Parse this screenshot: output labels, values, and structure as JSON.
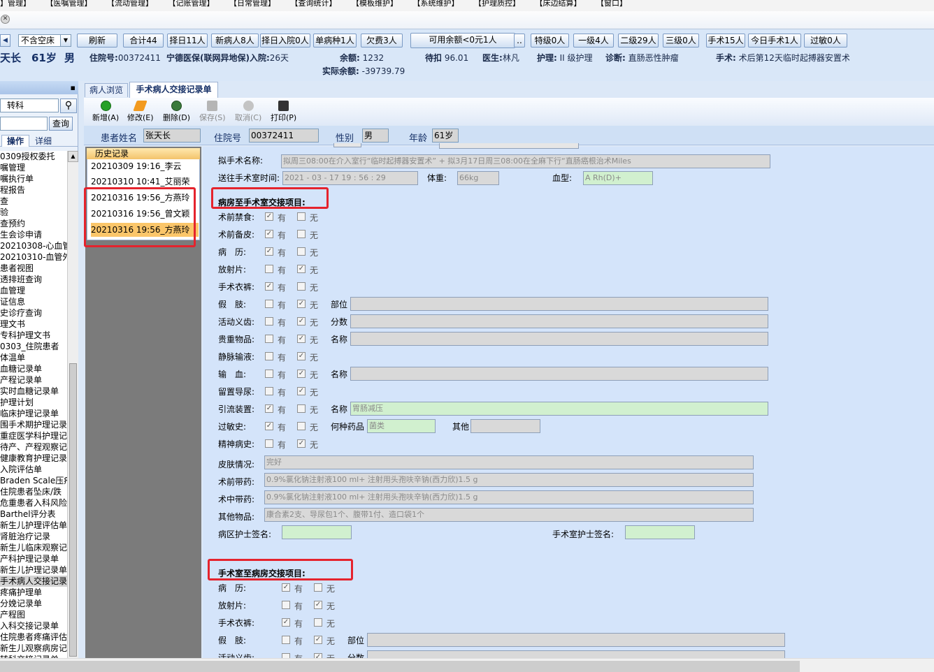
{
  "menu": [
    "】管理】",
    "【医嘱管理】",
    "【流动管理】",
    "【记账管理】",
    "【日常管理】",
    "【查询统计】",
    "【模板维护】",
    "【系统维护】",
    "【护理质控】",
    "【床边结算】",
    "【窗口】"
  ],
  "toolbar_top": {
    "bed_filter": "不含空床",
    "refresh": "刷新",
    "total": "合计44",
    "today_out": "择日11人",
    "new_patient": "新病人8人",
    "today_in": "择日入院0人",
    "single_disease": "单病种1人",
    "arrears": "欠费3人",
    "balance_filter": "可用余额<0元1人",
    "ellipsis": "..",
    "special_grade": "特级0人",
    "grade1": "一级4人",
    "grade2": "二级29人",
    "grade3": "三级0人",
    "surgery": "手术15人",
    "today_surgery": "今日手术1人",
    "allergy": "过敏0人"
  },
  "patient_header": {
    "name": "天长",
    "age": "61岁",
    "sex": "男",
    "admission_label": "住院号:",
    "admission_no": "00372411",
    "insurance": "宁德医保(联网异地保)入院:",
    "days": "26天",
    "balance_label": "余额:",
    "balance": "1232",
    "actual_balance_label": "实际余额:",
    "actual_balance": "-39739.79",
    "pending_label": "待扣",
    "pending": "96.01",
    "doctor_label": "医生:",
    "doctor": "林凡",
    "care_label": "护理:",
    "care": "II 级护理",
    "diagnosis_label": "诊断:",
    "diagnosis": "直肠恶性肿瘤",
    "surgery_label": "手术:",
    "surgery": "术后第12天临时起搏器安置术"
  },
  "left_panel": {
    "pin": "▪",
    "dept": "转科",
    "query": "查询",
    "tab_operate": "操作",
    "tab_detail": "详细",
    "tree": [
      "0309授权委托",
      "嘱管理",
      "嘱执行单",
      "程报告",
      "查",
      "验",
      "查预约",
      "生会诊申请",
      "20210308-心血管",
      "20210310-血管外",
      "患者视图",
      "透排班查询",
      "血管理",
      "证信息",
      "史诊疗查询",
      "理文书",
      "专科护理文书",
      "0303_住院患者",
      "体温单",
      "血糖记录单",
      "产程记录单",
      "实时血糖记录单",
      "护理计划",
      "临床护理记录单",
      "围手术期护理记录",
      "重症医学科护理记",
      "待产、产程观察记",
      "健康教育护理记录",
      "入院评估单",
      "Braden Scale压疮",
      "住院患者坠床/跌",
      "危重患者入科风险",
      "Barthel评分表",
      "新生儿护理评估单",
      "肾脏治疗记录",
      "新生儿临床观察记",
      "产科护理记录单",
      "新生儿护理记录单",
      "手术病人交接记录",
      "疼痛护理单",
      "分娩记录单",
      "产程图",
      "入科交接记录单",
      "住院患者疼痛评估",
      "新生儿观察病房记",
      "转科交接记录单"
    ]
  },
  "doc_tabs": {
    "browse": "病人浏览",
    "record": "手术病人交接记录单"
  },
  "tools": {
    "add": "新增(A)",
    "edit": "修改(E)",
    "delete": "删除(D)",
    "save": "保存(S)",
    "cancel": "取消(C)",
    "print": "打印(P)"
  },
  "patient_bar": {
    "name_label": "患者姓名",
    "name": "张天长",
    "id_label": "住院号",
    "id": "00372411",
    "sex_label": "性别",
    "sex": "男",
    "age_label": "年龄",
    "age": "61岁"
  },
  "history": {
    "header": "历史记录",
    "rows": [
      "20210309 19:16_李云",
      "20210310 10:41_艾丽荣",
      "20210316 19:56_方燕玲",
      "20210316 19:56_曾文颖",
      "20210316 19:56_方燕玲"
    ]
  },
  "form": {
    "planned_surgery_label": "拟手术名称:",
    "planned_surgery": "拟周三08:00在介入室行“临时起搏器安置术” + 拟3月17日周三08:00在全麻下行“直肠癌根治术Miles",
    "send_time_label": "送往手术室时间:",
    "send_time": "2021 - 03 - 17   19 : 56 : 29",
    "weight_label": "体重:",
    "weight": "66kg",
    "blood_label": "血型:",
    "blood": "A Rh(D)+",
    "section1_title": "病房至手术室交接项目:",
    "yes": "有",
    "no": "无",
    "s1_items": [
      {
        "label": "术前禁食:",
        "yes": true,
        "no": false
      },
      {
        "label": "术前备皮:",
        "yes": true,
        "no": false
      },
      {
        "label": "病　历:",
        "yes": true,
        "no": false
      },
      {
        "label": "放射片:",
        "yes": false,
        "no": true
      },
      {
        "label": "手术衣裤:",
        "yes": true,
        "no": false
      },
      {
        "label": "假　肢:",
        "yes": false,
        "no": true,
        "extra_label": "部位",
        "extra_value": ""
      },
      {
        "label": "活动义齿:",
        "yes": false,
        "no": true,
        "extra_label": "分数",
        "extra_value": ""
      },
      {
        "label": "贵重物品:",
        "yes": false,
        "no": true,
        "extra_label": "名称",
        "extra_value": ""
      },
      {
        "label": "静脉输液:",
        "yes": false,
        "no": true
      },
      {
        "label": "输　血:",
        "yes": false,
        "no": true,
        "extra_label": "名称",
        "extra_value": ""
      },
      {
        "label": "留置导尿:",
        "yes": false,
        "no": true
      },
      {
        "label": "引流装置:",
        "yes": true,
        "no": false,
        "extra_label": "名称",
        "extra_value": "胃肠减压"
      },
      {
        "label": "过敏史:",
        "yes": true,
        "no": false,
        "extra_label": "何种药品",
        "extra_value": "菌类",
        "extra2_label": "其他",
        "extra2_value": ""
      },
      {
        "label": "精神病史:",
        "yes": false,
        "no": true
      }
    ],
    "skin_label": "皮肤情况:",
    "skin": "完好",
    "preop_drug_label": "术前带药:",
    "preop_drug": "0.9%氯化钠注射液100 ml+ 注射用头孢呋辛钠(西力欣)1.5 g",
    "intraop_drug_label": "术中带药:",
    "intraop_drug": "0.9%氯化钠注射液100 ml+ 注射用头孢呋辛钠(西力欣)1.5 g",
    "other_items_label": "其他物品:",
    "other_items": "康合素2支、导尿包1个、腹带1付、造口袋1个",
    "ward_nurse_label": "病区护士签名:",
    "or_nurse_label": "手术室护士签名:",
    "section2_title": "手术室至病房交接项目:",
    "s2_items": [
      {
        "label": "病　历:",
        "yes": true,
        "no": false
      },
      {
        "label": "放射片:",
        "yes": false,
        "no": true
      },
      {
        "label": "手术衣裤:",
        "yes": true,
        "no": false
      },
      {
        "label": "假　肢:",
        "yes": false,
        "no": true,
        "extra_label": "部位"
      },
      {
        "label": "活动义齿:",
        "yes": false,
        "no": true,
        "extra_label": "分数"
      }
    ]
  }
}
